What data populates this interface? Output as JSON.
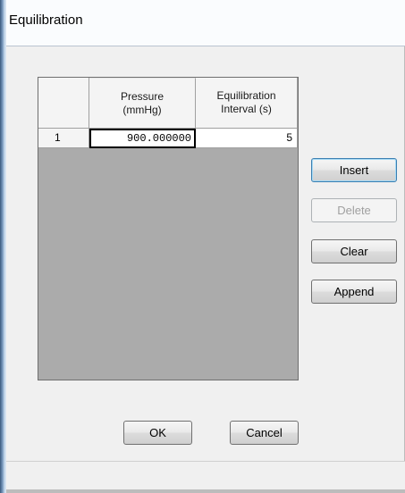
{
  "window": {
    "title": "Equilibration"
  },
  "grid": {
    "columns": [
      {
        "line1": "Pressure",
        "line2": "(mmHg)"
      },
      {
        "line1": "Equilibration",
        "line2": "Interval (s)"
      }
    ],
    "rows": [
      {
        "index": "1",
        "pressure": "900.000000",
        "interval": "5"
      }
    ]
  },
  "side_buttons": {
    "insert": "Insert",
    "delete": "Delete",
    "clear": "Clear",
    "append": "Append"
  },
  "dialog_buttons": {
    "ok": "OK",
    "cancel": "Cancel"
  }
}
